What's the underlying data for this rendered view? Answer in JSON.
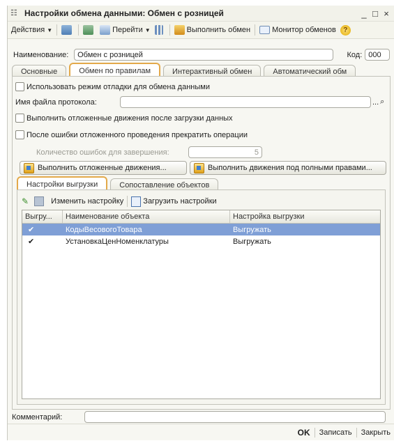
{
  "window": {
    "title": "Настройки обмена данными: Обмен с розницей"
  },
  "window_controls": {
    "minimize": "_",
    "maximize": "□",
    "close": "×"
  },
  "toolbar": {
    "actions_label": "Действия",
    "goto_label": "Перейти",
    "execute_exchange_label": "Выполнить обмен",
    "monitor_label": "Монитор обменов",
    "help_glyph": "?"
  },
  "form": {
    "name_label": "Наименование:",
    "name_value": "Обмен с розницей",
    "code_label": "Код:",
    "code_value": "000"
  },
  "tabs": [
    "Основные",
    "Обмен по правилам",
    "Интерактивный обмен",
    "Автоматический обм"
  ],
  "rules_tab": {
    "debug_mode_label": "Использовать режим отладки для обмена данными",
    "protocol_label": "Имя файла протокола:",
    "protocol_value": "",
    "browse_label": "...",
    "run_deferred_label": "Выполнить отложенные движения после загрузки данных",
    "stop_on_error_label": "После ошибки отложенного проведения прекратить операции",
    "error_count_label": "Количество ошибок для завершения:",
    "error_count_value": "5",
    "btn_run_deferred": "Выполнить отложенные движения...",
    "btn_run_full_rights": "Выполнить движения под полными правами..."
  },
  "subtabs": [
    "Настройки выгрузки",
    "Сопоставление объектов"
  ],
  "export_settings": {
    "change_setting_label": "Изменить настройку",
    "load_settings_label": "Загрузить настройки",
    "columns": [
      "Выгру...",
      "Наименование объекта",
      "Настройка выгрузки"
    ],
    "rows": [
      {
        "check": "✔",
        "name": "КодыВесовогоТовара",
        "setting": "Выгружать",
        "selected": true
      },
      {
        "check": "✔",
        "name": "УстановкаЦенНоменклатуры",
        "setting": "Выгружать",
        "selected": false
      }
    ]
  },
  "comment": {
    "label": "Комментарий:",
    "value": ""
  },
  "footer": {
    "ok": "OK",
    "save": "Записать",
    "close": "Закрыть"
  }
}
